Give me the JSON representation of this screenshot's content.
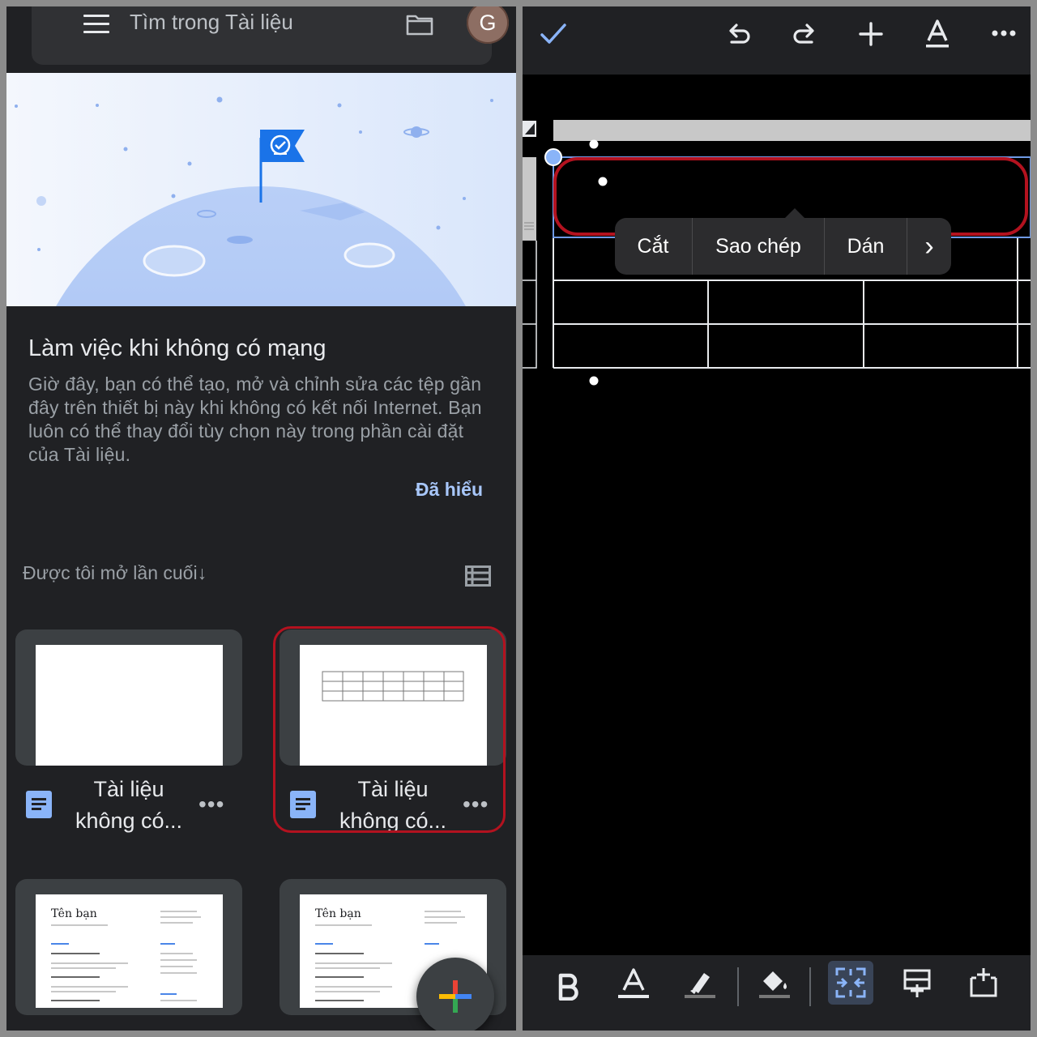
{
  "left": {
    "search": {
      "placeholder": "Tìm trong Tài liệu",
      "avatar_letter": "G"
    },
    "offline_card": {
      "title": "Làm việc khi không có mạng",
      "description": "Giờ đây, bạn có thể tạo, mở và chỉnh sửa các tệp gần đây trên thiết bị này khi không có kết nối Internet. Bạn luôn có thể thay đổi tùy chọn này trong phần cài đặt của Tài liệu.",
      "dismiss_label": "Đã hiểu"
    },
    "sort_label": "Được tôi mở lần cuối",
    "sort_arrow": "↓",
    "documents": [
      {
        "name_line1": "Tài liệu",
        "name_line2": "không có...",
        "thumbnail": "blank"
      },
      {
        "name_line1": "Tài liệu",
        "name_line2": "không có...",
        "thumbnail": "table"
      },
      {
        "heading": "Tên bạn",
        "thumbnail": "resume"
      },
      {
        "heading": "Tên bạn",
        "thumbnail": "resume"
      }
    ],
    "more_glyph": "•••"
  },
  "right": {
    "context_menu": {
      "cut": "Cắt",
      "copy": "Sao chép",
      "paste": "Dán",
      "more": "›"
    },
    "toolbar_icons": [
      "check-icon",
      "undo-icon",
      "redo-icon",
      "insert-icon",
      "text-format-icon",
      "more-icon"
    ],
    "bottom_icons": [
      "bold-icon",
      "text-color-icon",
      "highlight-icon",
      "fill-color-icon",
      "merge-cells-icon",
      "insert-row-icon",
      "insert-column-icon"
    ]
  },
  "colors": {
    "accent_blue": "#8ab4f8",
    "highlight_red": "#b3121f",
    "dark_surface": "#202124",
    "card_surface": "#3c4043"
  }
}
